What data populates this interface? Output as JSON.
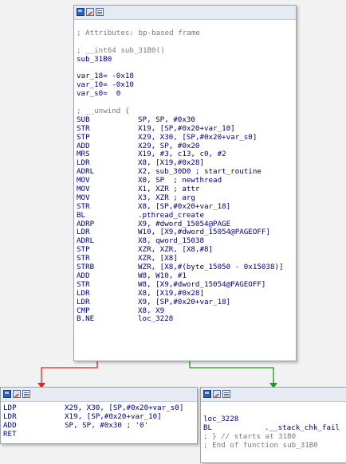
{
  "main_node": {
    "header_lines": [
      {
        "cls": "cmt",
        "text": "; Attributes: bp-based frame"
      },
      {
        "cls": "blank",
        "text": ""
      },
      {
        "cls": "cmt",
        "text": "; __int64 sub_31B0()"
      },
      {
        "cls": "lbl",
        "text": "sub_31B0"
      },
      {
        "cls": "blank",
        "text": ""
      },
      {
        "cls": "var",
        "text": "var_18= -0x18"
      },
      {
        "cls": "var",
        "text": "var_10= -0x10"
      },
      {
        "cls": "var",
        "text": "var_s0=  0"
      },
      {
        "cls": "blank",
        "text": ""
      },
      {
        "cls": "cmt",
        "text": "; __unwind {"
      }
    ],
    "instructions": [
      {
        "m": "SUB",
        "o": "SP, SP, #0x30"
      },
      {
        "m": "STR",
        "o": "X19, [SP,#0x20+var_10]"
      },
      {
        "m": "STP",
        "o": "X29, X30, [SP,#0x20+var_s0]"
      },
      {
        "m": "ADD",
        "o": "X29, SP, #0x20"
      },
      {
        "m": "MRS",
        "o": "X19, #3, c13, c0, #2"
      },
      {
        "m": "LDR",
        "o": "X8, [X19,#0x28]"
      },
      {
        "m": "ADRL",
        "o": "X2, sub_30D0 ; start_routine"
      },
      {
        "m": "MOV",
        "o": "X0, SP  ; newthread"
      },
      {
        "m": "MOV",
        "o": "X1, XZR ; attr"
      },
      {
        "m": "MOV",
        "o": "X3, XZR ; arg"
      },
      {
        "m": "STR",
        "o": "X8, [SP,#0x20+var_18]"
      },
      {
        "m": "BL",
        "o": ".pthread_create"
      },
      {
        "m": "ADRP",
        "o": "X9, #dword_15054@PAGE"
      },
      {
        "m": "LDR",
        "o": "W10, [X9,#dword_15054@PAGEOFF]"
      },
      {
        "m": "ADRL",
        "o": "X8, qword_15038"
      },
      {
        "m": "STP",
        "o": "XZR, XZR, [X8,#8]"
      },
      {
        "m": "STR",
        "o": "XZR, [X8]"
      },
      {
        "m": "STRB",
        "o": "WZR, [X8,#(byte_15050 - 0x15038)]"
      },
      {
        "m": "ADD",
        "o": "W8, W10, #1"
      },
      {
        "m": "STR",
        "o": "W8, [X9,#dword_15054@PAGEOFF]"
      },
      {
        "m": "LDR",
        "o": "X8, [X19,#0x28]"
      },
      {
        "m": "LDR",
        "o": "X9, [SP,#0x20+var_18]"
      },
      {
        "m": "CMP",
        "o": "X8, X9"
      },
      {
        "m": "B.NE",
        "o": "loc_3228"
      }
    ]
  },
  "left_node": {
    "instructions": [
      {
        "m": "LDP",
        "o": "X29, X30, [SP,#0x20+var_s0]"
      },
      {
        "m": "LDR",
        "o": "X19, [SP,#0x20+var_10]"
      },
      {
        "m": "ADD",
        "o": "SP, SP, #0x30 ; '0'"
      },
      {
        "m": "RET",
        "o": ""
      }
    ]
  },
  "right_node": {
    "lines": [
      {
        "cls": "blank",
        "text": ""
      },
      {
        "cls": "lbl",
        "text": "loc_3228"
      },
      {
        "cls": "ins",
        "m": "BL",
        "o": ".__stack_chk_fail"
      },
      {
        "cls": "cmt",
        "text": "; } // starts at 31B0"
      },
      {
        "cls": "cmt",
        "text": "; End of function sub_31B0"
      }
    ]
  },
  "edges": {
    "false_color": "#e8231a",
    "true_color": "#1f9a1f"
  }
}
